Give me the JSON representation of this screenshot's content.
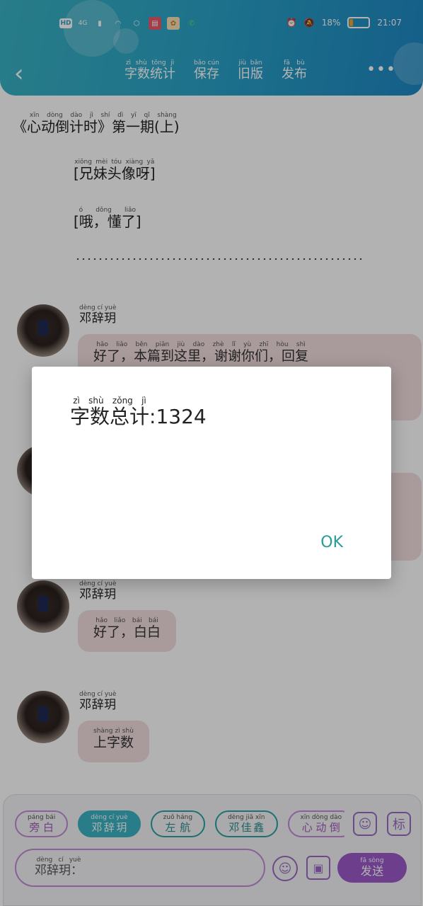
{
  "status_bar": {
    "left_icons": [
      "HD",
      "4G",
      "signal",
      "wifi",
      "shield",
      "book",
      "app",
      "phone"
    ],
    "right_icons": [
      "alarm-icon",
      "mute-icon"
    ],
    "battery": "18%",
    "battery_level": 0.18,
    "time": "21:07"
  },
  "header": {
    "actions": [
      {
        "rb": "字数统计",
        "rt": "zì shù tǒng jì"
      },
      {
        "rb": "保存",
        "rt": "bǎo cún"
      },
      {
        "rb": "旧版",
        "rt": "jiù bǎn"
      },
      {
        "rb": "发布",
        "rt": "fā bù"
      }
    ],
    "more": "•••"
  },
  "content": {
    "title": {
      "pre": "《",
      "rb": "心动倒计时》第一期(上)",
      "rt": "xīn dòng dào jì shí dì yī qī shàng"
    },
    "tag1": {
      "rb": "[兄妹头像呀]",
      "rt": "xiōng mèi tóu xiàng yā"
    },
    "tag2": {
      "rb": "[哦，懂了]",
      "rt": "ó dǒng liǎo"
    },
    "messages": [
      {
        "sender": "邓辞玥",
        "sender_rt": "dèng cí yuè",
        "text": "好了，本篇到这里，谢谢你们，回复",
        "text_rt": "hǎo liǎo běn piān jiù dào zhè lǐ yù zhī hòu shì"
      },
      {
        "sender": "邓辞玥",
        "sender_rt": "dèng cí yuè",
        "text": "好了，白白",
        "text_rt": "hǎo liǎo bái bái"
      },
      {
        "sender": "邓辞玥",
        "sender_rt": "dèng cí yuè",
        "text": "上字数",
        "text_rt": "shàng zì shù"
      }
    ]
  },
  "dialog": {
    "label": {
      "rb": "字数总计",
      "rt": "zì shù zǒng jì"
    },
    "value": ":1324",
    "ok": "OK"
  },
  "bottom": {
    "chips": [
      {
        "rb": "旁白",
        "rt": "páng bái",
        "style": "purple"
      },
      {
        "rb": "邓辞玥",
        "rt": "dèng cí yuè",
        "style": "active"
      },
      {
        "rb": "左航",
        "rt": "zuǒ háng",
        "style": "teal"
      },
      {
        "rb": "邓佳鑫",
        "rt": "dèng jiā xīn",
        "style": "teal"
      },
      {
        "rb": "心动倒",
        "rt": "xīn dòng dào",
        "style": "purple"
      }
    ],
    "label_btn": "标",
    "input_value": {
      "rb": "邓辞玥：",
      "rt": "dèng cí yuè"
    },
    "send": {
      "rb": "发送",
      "rt": "fā sòng"
    }
  },
  "colors": {
    "header": "#2aa3c8",
    "accent_purple": "#9b59c9",
    "ok": "#2a9a9a",
    "bubble": "#f3dede"
  }
}
